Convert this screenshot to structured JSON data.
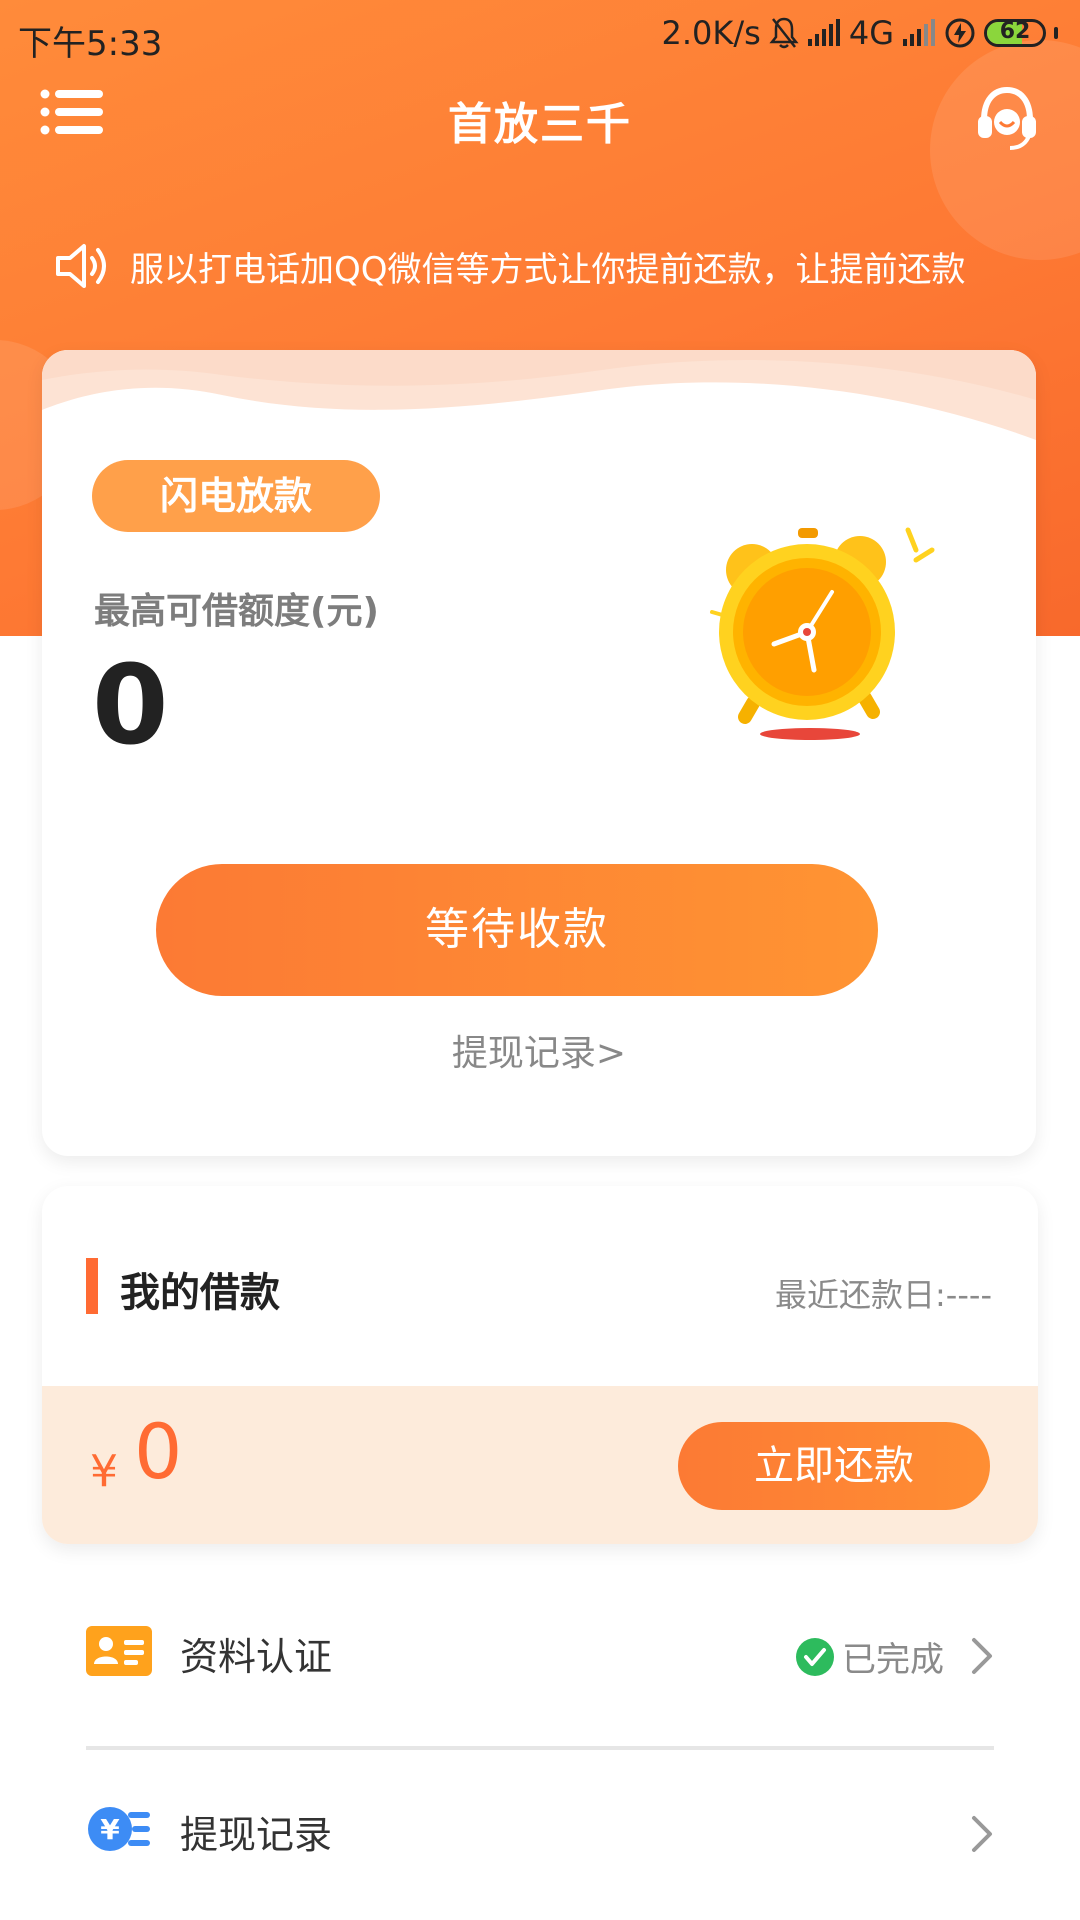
{
  "status_bar": {
    "time": "下午5:33",
    "speed": "2.0K/s",
    "network": "4G",
    "battery": "62",
    "battery_level": 0.62
  },
  "header": {
    "title": "首放三千",
    "menu_icon": "menu-icon",
    "support_icon": "headset-icon"
  },
  "notice": {
    "icon": "speaker-icon",
    "text": "服以打电话加QQ微信等方式让你提前还款，让提前还款"
  },
  "loan_card": {
    "tag": "闪电放款",
    "limit_label": "最高可借额度(元)",
    "limit_value": "0",
    "illustration": "alarm-clock-icon",
    "button_label": "等待收款",
    "withdraw_link": "提现记录>"
  },
  "my_loan": {
    "title": "我的借款",
    "recent_repay": "最近还款日:----",
    "currency": "¥",
    "amount": "0",
    "repay_button": "立即还款"
  },
  "list": {
    "items": [
      {
        "label": "资料认证",
        "status": "已完成",
        "icon": "id-card-icon"
      },
      {
        "label": "提现记录",
        "status": "",
        "icon": "yen-list-icon"
      }
    ]
  },
  "colors": {
    "brand_orange": "#fe7a34",
    "accent": "#ff6b33",
    "success": "#2dbb5d"
  }
}
